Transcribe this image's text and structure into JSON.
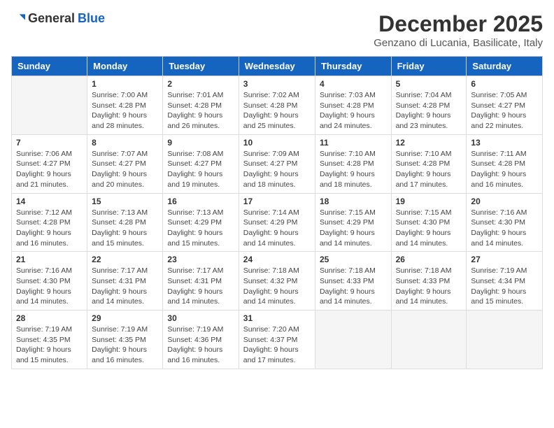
{
  "logo": {
    "general": "General",
    "blue": "Blue"
  },
  "title": {
    "month_year": "December 2025",
    "location": "Genzano di Lucania, Basilicate, Italy"
  },
  "weekdays": [
    "Sunday",
    "Monday",
    "Tuesday",
    "Wednesday",
    "Thursday",
    "Friday",
    "Saturday"
  ],
  "weeks": [
    [
      {
        "day": "",
        "empty": true
      },
      {
        "day": "1",
        "sunrise": "7:00 AM",
        "sunset": "4:28 PM",
        "daylight": "9 hours and 28 minutes."
      },
      {
        "day": "2",
        "sunrise": "7:01 AM",
        "sunset": "4:28 PM",
        "daylight": "9 hours and 26 minutes."
      },
      {
        "day": "3",
        "sunrise": "7:02 AM",
        "sunset": "4:28 PM",
        "daylight": "9 hours and 25 minutes."
      },
      {
        "day": "4",
        "sunrise": "7:03 AM",
        "sunset": "4:28 PM",
        "daylight": "9 hours and 24 minutes."
      },
      {
        "day": "5",
        "sunrise": "7:04 AM",
        "sunset": "4:28 PM",
        "daylight": "9 hours and 23 minutes."
      },
      {
        "day": "6",
        "sunrise": "7:05 AM",
        "sunset": "4:27 PM",
        "daylight": "9 hours and 22 minutes."
      }
    ],
    [
      {
        "day": "7",
        "sunrise": "7:06 AM",
        "sunset": "4:27 PM",
        "daylight": "9 hours and 21 minutes."
      },
      {
        "day": "8",
        "sunrise": "7:07 AM",
        "sunset": "4:27 PM",
        "daylight": "9 hours and 20 minutes."
      },
      {
        "day": "9",
        "sunrise": "7:08 AM",
        "sunset": "4:27 PM",
        "daylight": "9 hours and 19 minutes."
      },
      {
        "day": "10",
        "sunrise": "7:09 AM",
        "sunset": "4:27 PM",
        "daylight": "9 hours and 18 minutes."
      },
      {
        "day": "11",
        "sunrise": "7:10 AM",
        "sunset": "4:28 PM",
        "daylight": "9 hours and 18 minutes."
      },
      {
        "day": "12",
        "sunrise": "7:10 AM",
        "sunset": "4:28 PM",
        "daylight": "9 hours and 17 minutes."
      },
      {
        "day": "13",
        "sunrise": "7:11 AM",
        "sunset": "4:28 PM",
        "daylight": "9 hours and 16 minutes."
      }
    ],
    [
      {
        "day": "14",
        "sunrise": "7:12 AM",
        "sunset": "4:28 PM",
        "daylight": "9 hours and 16 minutes."
      },
      {
        "day": "15",
        "sunrise": "7:13 AM",
        "sunset": "4:28 PM",
        "daylight": "9 hours and 15 minutes."
      },
      {
        "day": "16",
        "sunrise": "7:13 AM",
        "sunset": "4:29 PM",
        "daylight": "9 hours and 15 minutes."
      },
      {
        "day": "17",
        "sunrise": "7:14 AM",
        "sunset": "4:29 PM",
        "daylight": "9 hours and 14 minutes."
      },
      {
        "day": "18",
        "sunrise": "7:15 AM",
        "sunset": "4:29 PM",
        "daylight": "9 hours and 14 minutes."
      },
      {
        "day": "19",
        "sunrise": "7:15 AM",
        "sunset": "4:30 PM",
        "daylight": "9 hours and 14 minutes."
      },
      {
        "day": "20",
        "sunrise": "7:16 AM",
        "sunset": "4:30 PM",
        "daylight": "9 hours and 14 minutes."
      }
    ],
    [
      {
        "day": "21",
        "sunrise": "7:16 AM",
        "sunset": "4:30 PM",
        "daylight": "9 hours and 14 minutes."
      },
      {
        "day": "22",
        "sunrise": "7:17 AM",
        "sunset": "4:31 PM",
        "daylight": "9 hours and 14 minutes."
      },
      {
        "day": "23",
        "sunrise": "7:17 AM",
        "sunset": "4:31 PM",
        "daylight": "9 hours and 14 minutes."
      },
      {
        "day": "24",
        "sunrise": "7:18 AM",
        "sunset": "4:32 PM",
        "daylight": "9 hours and 14 minutes."
      },
      {
        "day": "25",
        "sunrise": "7:18 AM",
        "sunset": "4:33 PM",
        "daylight": "9 hours and 14 minutes."
      },
      {
        "day": "26",
        "sunrise": "7:18 AM",
        "sunset": "4:33 PM",
        "daylight": "9 hours and 14 minutes."
      },
      {
        "day": "27",
        "sunrise": "7:19 AM",
        "sunset": "4:34 PM",
        "daylight": "9 hours and 15 minutes."
      }
    ],
    [
      {
        "day": "28",
        "sunrise": "7:19 AM",
        "sunset": "4:35 PM",
        "daylight": "9 hours and 15 minutes."
      },
      {
        "day": "29",
        "sunrise": "7:19 AM",
        "sunset": "4:35 PM",
        "daylight": "9 hours and 16 minutes."
      },
      {
        "day": "30",
        "sunrise": "7:19 AM",
        "sunset": "4:36 PM",
        "daylight": "9 hours and 16 minutes."
      },
      {
        "day": "31",
        "sunrise": "7:20 AM",
        "sunset": "4:37 PM",
        "daylight": "9 hours and 17 minutes."
      },
      {
        "day": "",
        "empty": true
      },
      {
        "day": "",
        "empty": true
      },
      {
        "day": "",
        "empty": true
      }
    ]
  ]
}
